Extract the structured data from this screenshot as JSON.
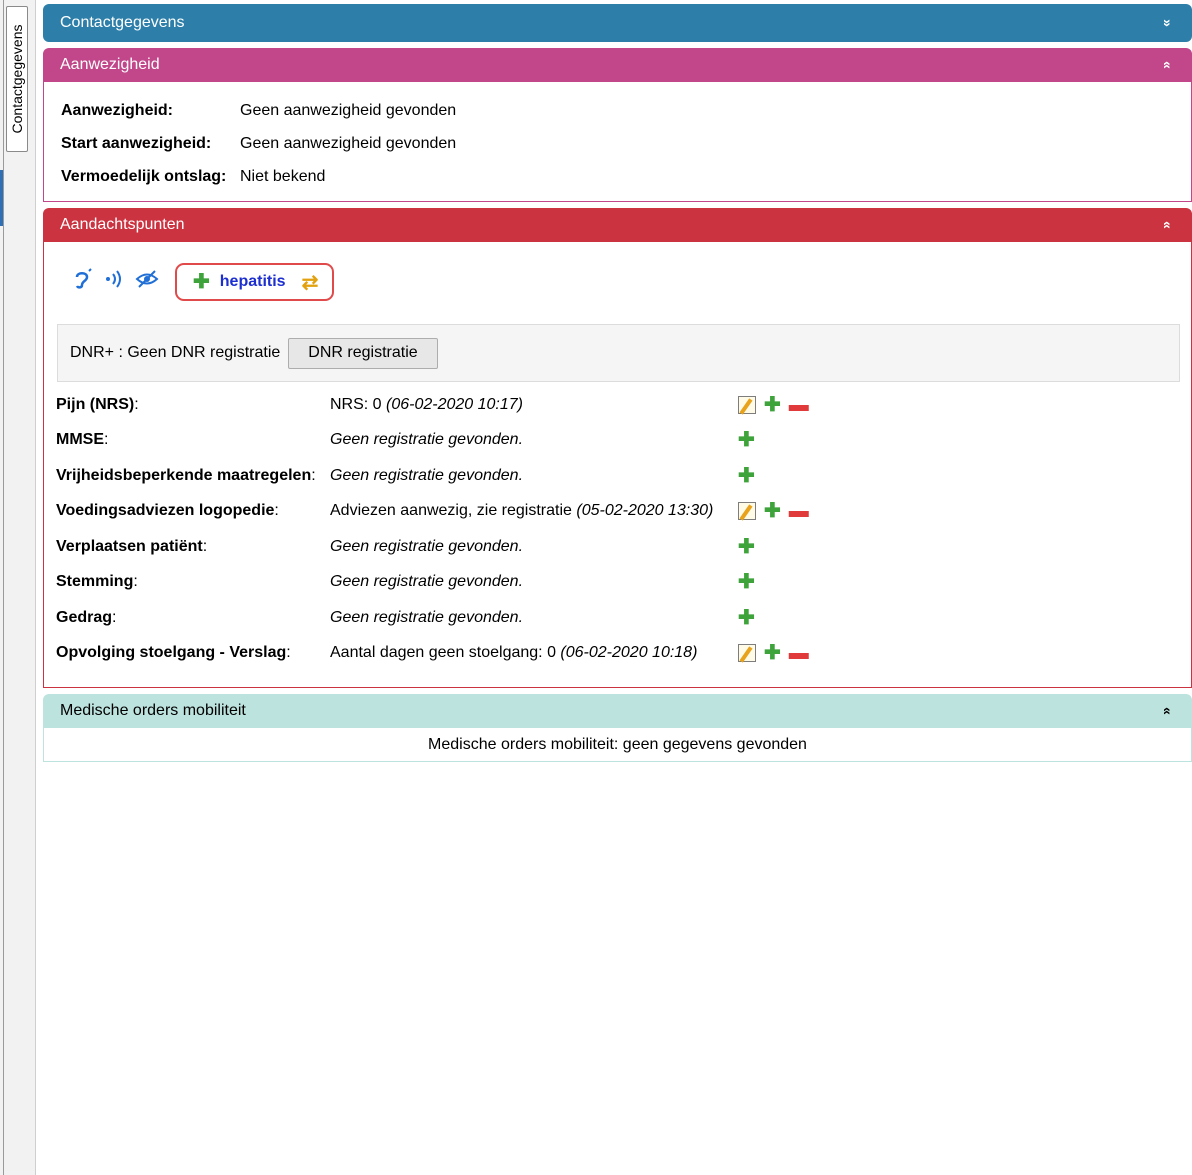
{
  "side_tab": {
    "label": "Contactgegevens"
  },
  "panels": {
    "contact": {
      "title": "Contactgegevens",
      "toggle": "»"
    },
    "aanwezigheid": {
      "title": "Aanwezigheid",
      "toggle": "«",
      "rows": [
        {
          "label": "Aanwezigheid:",
          "value": "Geen aanwezigheid gevonden"
        },
        {
          "label": "Start aanwezigheid:",
          "value": "Geen aanwezigheid gevonden"
        },
        {
          "label": "Vermoedelijk ontslag:",
          "value": "Niet bekend"
        }
      ]
    },
    "aandachtspunten": {
      "title": "Aandachtspunten",
      "toggle": "«",
      "icons": [
        "ear-icon",
        "hearing-aid-icon",
        "eye-crossed-icon"
      ],
      "tag": {
        "label": "hepatitis"
      },
      "dnr": {
        "text": "DNR+ : Geen DNR registratie",
        "button": "DNR registratie"
      },
      "registrations": [
        {
          "label": "Pijn (NRS)",
          "value": "NRS: 0 ",
          "date": "(06-02-2020 10:17)"
        },
        {
          "label": "MMSE",
          "value": "",
          "date": "Geen registratie gevonden."
        },
        {
          "label": "Vrijheidsbeperkende maatregelen",
          "value": "",
          "date": "Geen registratie gevonden."
        },
        {
          "label": "Voedingsadviezen logopedie",
          "value": "Adviezen aanwezig, zie registratie ",
          "date": "(05-02-2020 13:30)"
        },
        {
          "label": "Verplaatsen patiënt",
          "value": "",
          "date": "Geen registratie gevonden."
        },
        {
          "label": "Stemming",
          "value": "",
          "date": "Geen registratie gevonden."
        },
        {
          "label": "Gedrag",
          "value": "",
          "date": "Geen registratie gevonden."
        },
        {
          "label": "Opvolging stoelgang - Verslag",
          "value": "Aantal dagen geen stoelgang: 0 ",
          "date": "(06-02-2020 10:18)"
        }
      ]
    },
    "mobiliteit": {
      "title": "Medische orders mobiliteit",
      "toggle": "«",
      "empty": "Medische orders mobiliteit: geen gegevens gevonden"
    }
  }
}
